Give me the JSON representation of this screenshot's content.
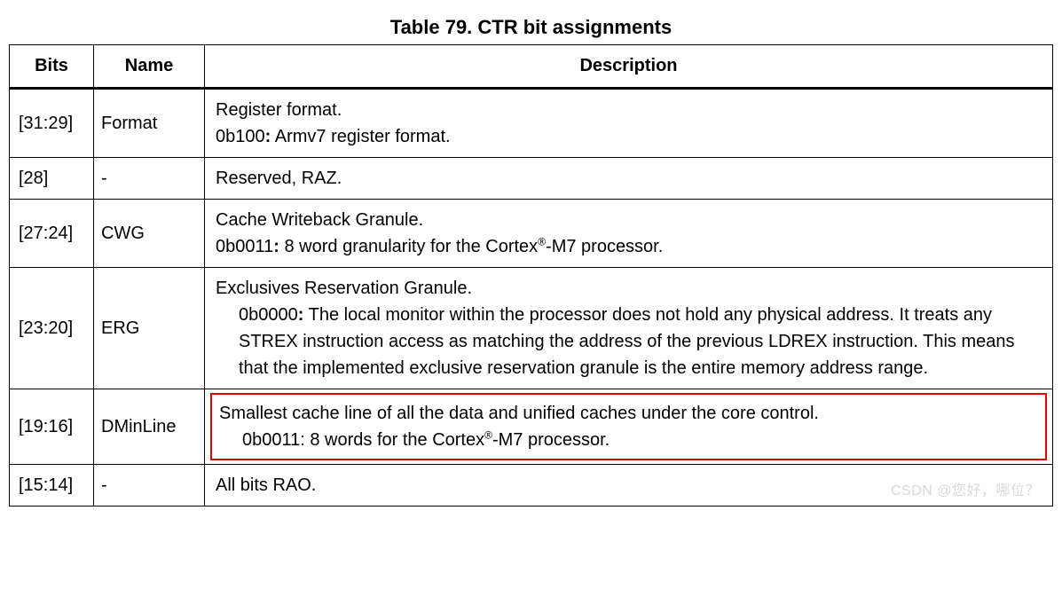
{
  "title": "Table 79. CTR bit assignments",
  "headers": {
    "bits": "Bits",
    "name": "Name",
    "desc": "Description"
  },
  "rows": {
    "r0": {
      "bits": "[31:29]",
      "name": "Format",
      "l1": "Register format.",
      "l2a": "0b100",
      "l2b": " Armv7 register format."
    },
    "r1": {
      "bits": "[28]",
      "name": "-",
      "l1": "Reserved, RAZ."
    },
    "r2": {
      "bits": "[27:24]",
      "name": "CWG",
      "l1": "Cache Writeback Granule.",
      "l2a": "0b0011",
      "l2b_pre": " 8 word granularity for the Cortex",
      "l2b_sup": "®",
      "l2b_post": "-M7 processor."
    },
    "r3": {
      "bits": "[23:20]",
      "name": "ERG",
      "l1": "Exclusives Reservation Granule.",
      "l2a": "0b0000",
      "l2b": " The local monitor within the processor does not hold any physical address. It treats any STREX instruction access as matching the address of the previous LDREX instruction. This means that the implemented exclusive reservation granule is the entire memory address range."
    },
    "r4": {
      "bits": "[19:16]",
      "name": "DMinLine",
      "l1": "Smallest cache line of all the data and unified caches under the core control.",
      "l2_pre": "0b0011: 8 words for the Cortex",
      "l2_sup": "®",
      "l2_post": "-M7 processor."
    },
    "r5": {
      "bits": "[15:14]",
      "name": "-",
      "l1": "All bits RAO."
    }
  },
  "watermark": "CSDN @您好，哪位？"
}
